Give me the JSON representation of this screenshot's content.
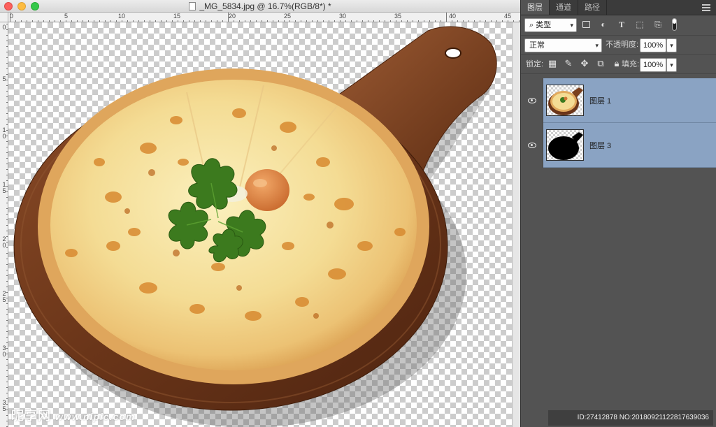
{
  "window": {
    "title": "_MG_5834.jpg @ 16.7%(RGB/8*) *"
  },
  "rulers": {
    "top_labels": [
      "0",
      "5",
      "10",
      "15",
      "20",
      "25",
      "30",
      "35",
      "40",
      "45"
    ],
    "left_labels": [
      "0",
      "5",
      "1\n0",
      "1\n5",
      "2\n0",
      "2\n5",
      "3\n0",
      "3\n5"
    ]
  },
  "panel": {
    "tabs": [
      {
        "label": "图层",
        "active": true
      },
      {
        "label": "通道",
        "active": false
      },
      {
        "label": "路径",
        "active": false
      }
    ],
    "filter": {
      "kind_label": "类型",
      "icons": [
        "image-filter-icon",
        "adjustment-filter-icon",
        "type-filter-icon",
        "shape-filter-icon",
        "smart-object-filter-icon"
      ]
    },
    "blend": {
      "mode": "正常",
      "opacity_label": "不透明度:",
      "opacity_value": "100%"
    },
    "lock": {
      "label": "锁定:",
      "icons": [
        "lock-transparent-icon",
        "lock-paint-icon",
        "lock-move-icon",
        "lock-artboard-icon",
        "lock-all-icon"
      ],
      "fill_label": "填充:",
      "fill_value": "100%"
    },
    "layers": [
      {
        "name": "图层 1",
        "visible": true,
        "selected": true,
        "thumb": "pizza"
      },
      {
        "name": "图层 3",
        "visible": true,
        "selected": true,
        "thumb": "silhouette"
      }
    ]
  },
  "watermarks": {
    "left": "昵享网",
    "left_url": "www.nipic.com",
    "right": "ID:27412878 NO:20180921122817639036"
  },
  "colors": {
    "panel_bg": "#535353",
    "layer_selected": "#8aa3c3",
    "board_wood": "#6b3a1f",
    "crust": "#e8b26a",
    "cheese": "#f6e3a0",
    "parsley": "#3c7a1e"
  }
}
